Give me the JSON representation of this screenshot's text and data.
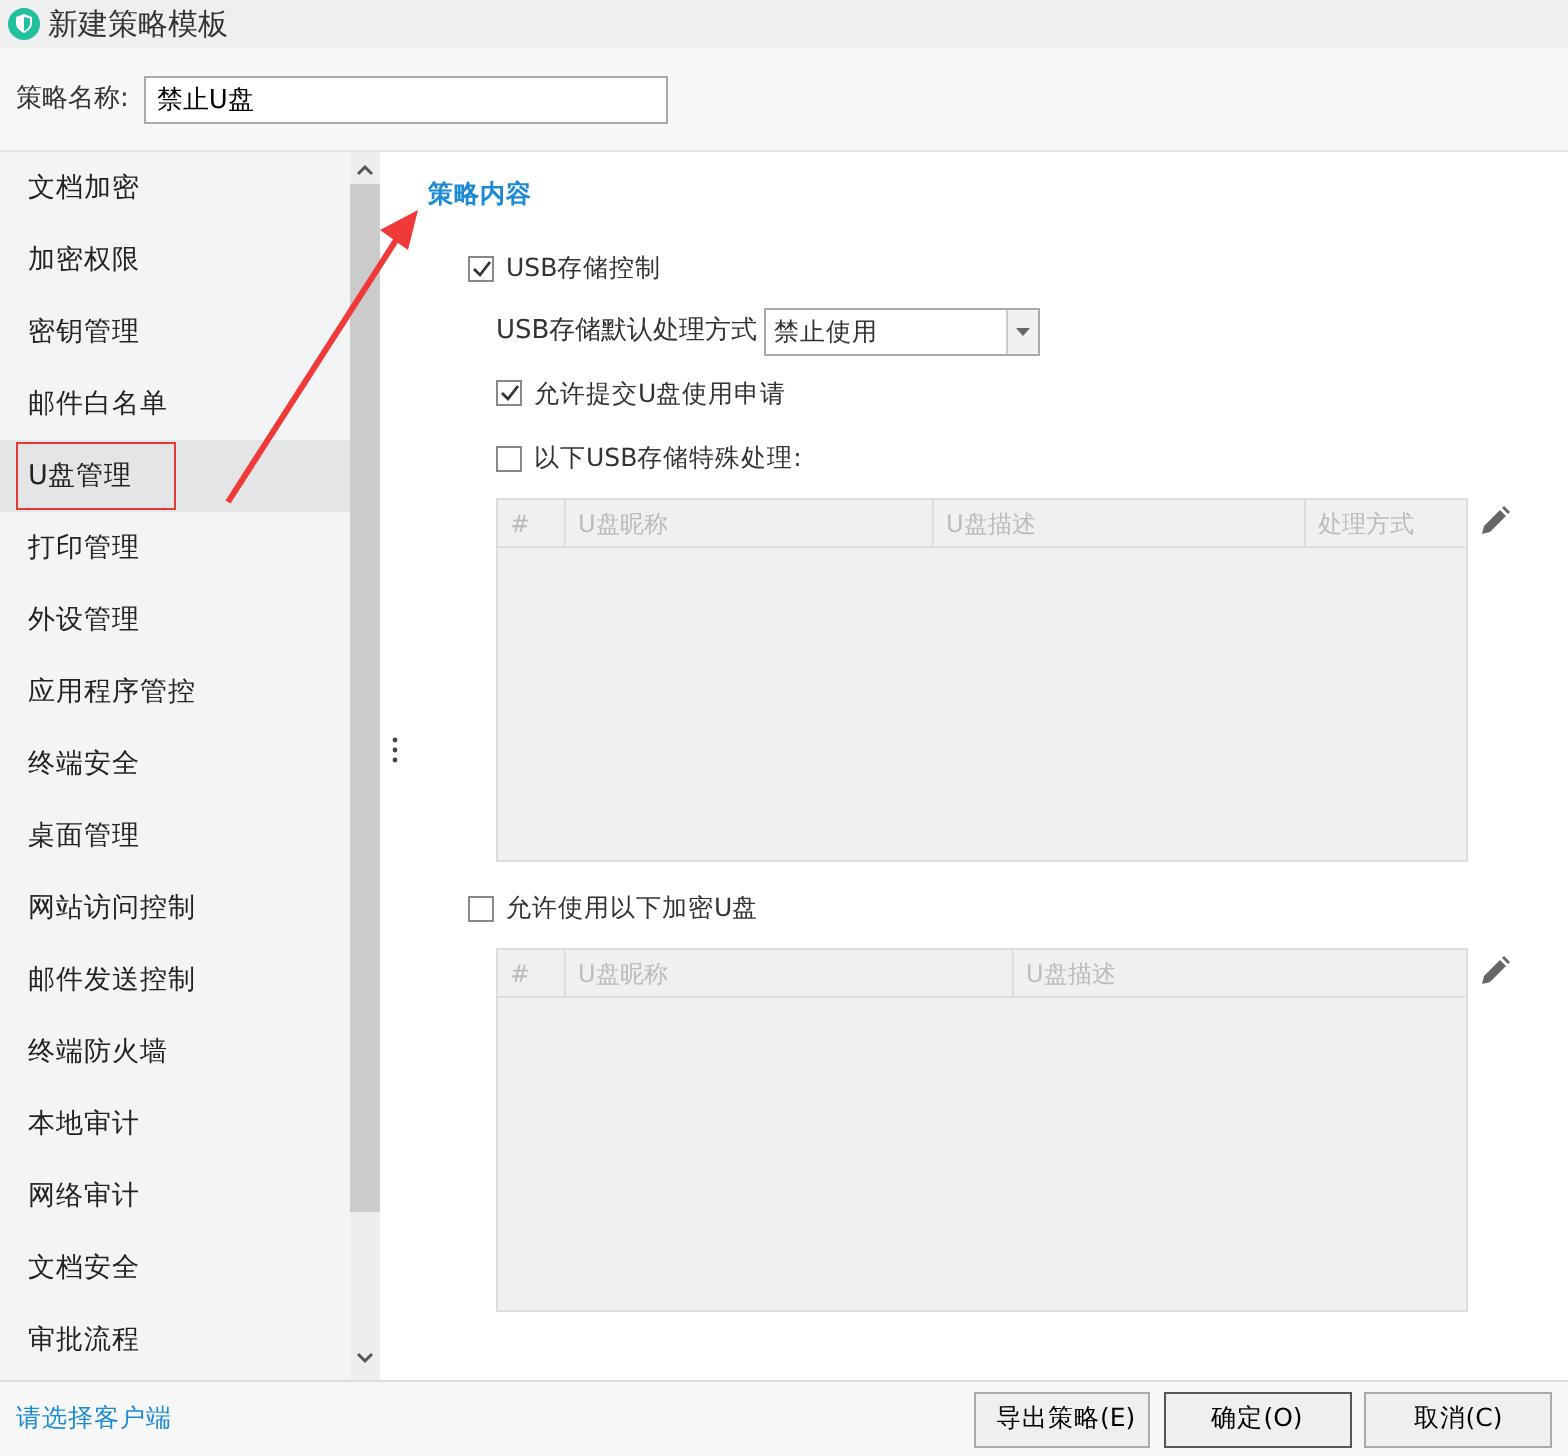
{
  "window": {
    "title": "新建策略模板"
  },
  "name_field": {
    "label": "策略名称:",
    "value": "禁止U盘"
  },
  "sidebar": {
    "items": [
      {
        "label": "文档加密",
        "selected": false
      },
      {
        "label": "加密权限",
        "selected": false
      },
      {
        "label": "密钥管理",
        "selected": false
      },
      {
        "label": "邮件白名单",
        "selected": false
      },
      {
        "label": "U盘管理",
        "selected": true
      },
      {
        "label": "打印管理",
        "selected": false
      },
      {
        "label": "外设管理",
        "selected": false
      },
      {
        "label": "应用程序管控",
        "selected": false
      },
      {
        "label": "终端安全",
        "selected": false
      },
      {
        "label": "桌面管理",
        "selected": false
      },
      {
        "label": "网站访问控制",
        "selected": false
      },
      {
        "label": "邮件发送控制",
        "selected": false
      },
      {
        "label": "终端防火墙",
        "selected": false
      },
      {
        "label": "本地审计",
        "selected": false
      },
      {
        "label": "网络审计",
        "selected": false
      },
      {
        "label": "文档安全",
        "selected": false
      },
      {
        "label": "审批流程",
        "selected": false
      }
    ]
  },
  "content": {
    "heading": "策略内容",
    "usb_control": {
      "label": "USB存储控制",
      "checked": true
    },
    "default_action": {
      "label": "USB存储默认处理方式",
      "value": "禁止使用"
    },
    "allow_request": {
      "label": "允许提交U盘使用申请",
      "checked": true
    },
    "special": {
      "label": "以下USB存储特殊处理:",
      "checked": false
    },
    "special_table": {
      "columns": [
        "#",
        "U盘昵称",
        "U盘描述",
        "处理方式"
      ]
    },
    "encrypted": {
      "label": "允许使用以下加密U盘",
      "checked": false
    },
    "encrypted_table": {
      "columns": [
        "#",
        "U盘昵称",
        "U盘描述"
      ]
    }
  },
  "footer": {
    "link": "请选择客户端",
    "buttons": [
      "导出策略(E)",
      "确定(O)",
      "取消(C)"
    ]
  }
}
